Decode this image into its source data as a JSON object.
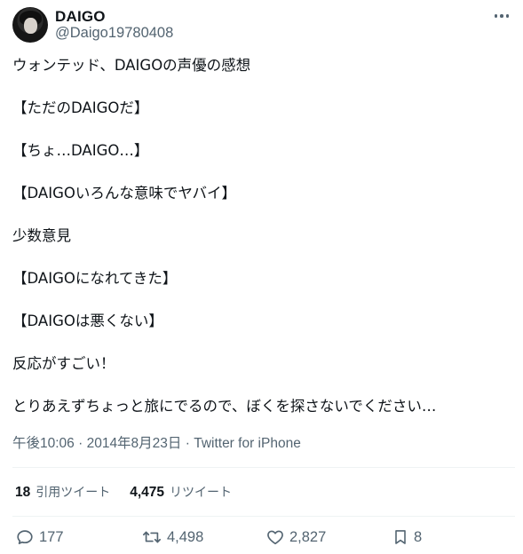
{
  "author": {
    "display_name": "DAIGO",
    "handle": "@Daigo19780408"
  },
  "tweet": {
    "lines": [
      "ウォンテッド、DAIGOの声優の感想",
      "",
      "【ただのDAIGOだ】",
      "",
      "【ちょ…DAIGO…】",
      "",
      "【DAIGOいろんな意味でヤバイ】",
      "",
      "少数意見",
      "",
      "【DAIGOになれてきた】",
      "",
      "【DAIGOは悪くない】",
      "",
      "反応がすごい！",
      "",
      "とりあえずちょっと旅にでるので、ぼくを探さないでください…"
    ]
  },
  "meta": {
    "time": "午後10:06",
    "separator": " · ",
    "date": "2014年8月23日",
    "source": "Twitter for iPhone"
  },
  "stats": {
    "quotes_count": "18",
    "quotes_label": "引用ツイート",
    "retweets_count": "4,475",
    "retweets_label": "リツイート"
  },
  "actions": {
    "reply_count": "177",
    "retweet_count": "4,498",
    "like_count": "2,827",
    "bookmark_count": "8"
  },
  "icons": {
    "more": "more-horizontal-icon",
    "reply": "reply-icon",
    "retweet": "retweet-icon",
    "like": "heart-icon",
    "bookmark": "bookmark-icon"
  },
  "colors": {
    "text": "#0f1419",
    "secondary": "#536471",
    "divider": "#eff3f4"
  }
}
